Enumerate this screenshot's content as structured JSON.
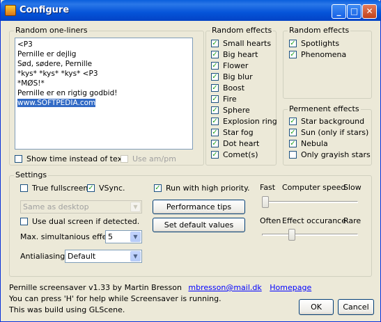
{
  "window": {
    "title": "Configure"
  },
  "oneliners": {
    "legend": "Random one-liners",
    "lines": [
      "<P3",
      "Pernille er dejlig",
      "Sød, sødere, Pernille",
      "*kys* *kys* *kys* <P3",
      "*MØS!*",
      "Pernille er en rigtig godbid!",
      "www.SOFTPEDIA.com"
    ],
    "show_time": {
      "label": "Show time instead of text",
      "checked": false
    },
    "use_ampm": {
      "label": "Use am/pm",
      "checked": false,
      "disabled": true
    }
  },
  "random_effects": {
    "legend": "Random effects",
    "items": [
      {
        "label": "Small hearts",
        "checked": true
      },
      {
        "label": "Big heart",
        "checked": true
      },
      {
        "label": "Flower",
        "checked": true
      },
      {
        "label": "Big blur",
        "checked": true
      },
      {
        "label": "Boost",
        "checked": true
      },
      {
        "label": "Fire",
        "checked": true
      },
      {
        "label": "Sphere",
        "checked": true
      },
      {
        "label": "Explosion ring",
        "checked": true
      },
      {
        "label": "Star fog",
        "checked": true
      },
      {
        "label": "Dot heart",
        "checked": true
      },
      {
        "label": "Comet(s)",
        "checked": true
      }
    ]
  },
  "random_effects2": {
    "legend": "Random effects",
    "items": [
      {
        "label": "Spotlights",
        "checked": true
      },
      {
        "label": "Phenomena",
        "checked": true
      }
    ]
  },
  "permanent_effects": {
    "legend": "Permenent effects",
    "items": [
      {
        "label": "Star background",
        "checked": true
      },
      {
        "label": "Sun (only if stars)",
        "checked": true
      },
      {
        "label": "Nebula",
        "checked": true
      },
      {
        "label": "Only grayish stars",
        "checked": false
      }
    ]
  },
  "settings": {
    "legend": "Settings",
    "true_fullscreen": {
      "label": "True fullscreen.",
      "checked": false
    },
    "vsync": {
      "label": "VSync.",
      "checked": true
    },
    "high_priority": {
      "label": "Run with high priority.",
      "checked": true
    },
    "resolution_select": {
      "value": "Same as desktop"
    },
    "dual_screen": {
      "label": "Use dual screen if detected.",
      "checked": false
    },
    "max_effects_label": "Max. simultanious effects",
    "max_effects_value": "5",
    "antialiasing_label": "Antialiasing",
    "antialiasing_value": "Default",
    "performance_tips": "Performance tips",
    "set_defaults": "Set default values",
    "speed": {
      "left": "Fast",
      "title": "Computer speed",
      "right": "Slow",
      "level": 0.0
    },
    "occurance": {
      "left": "Often",
      "title": "Effect occurance",
      "right": "Rare",
      "level": 0.3
    }
  },
  "footer": {
    "line1": "Pernille screensaver v1.33 by Martin Bresson",
    "email": "mbresson@mail.dk",
    "homepage": "Homepage",
    "line2": "You can press 'H' for help while Screensaver is running.",
    "line3": "This was build using GLScene.",
    "ok": "OK",
    "cancel": "Cancel"
  }
}
